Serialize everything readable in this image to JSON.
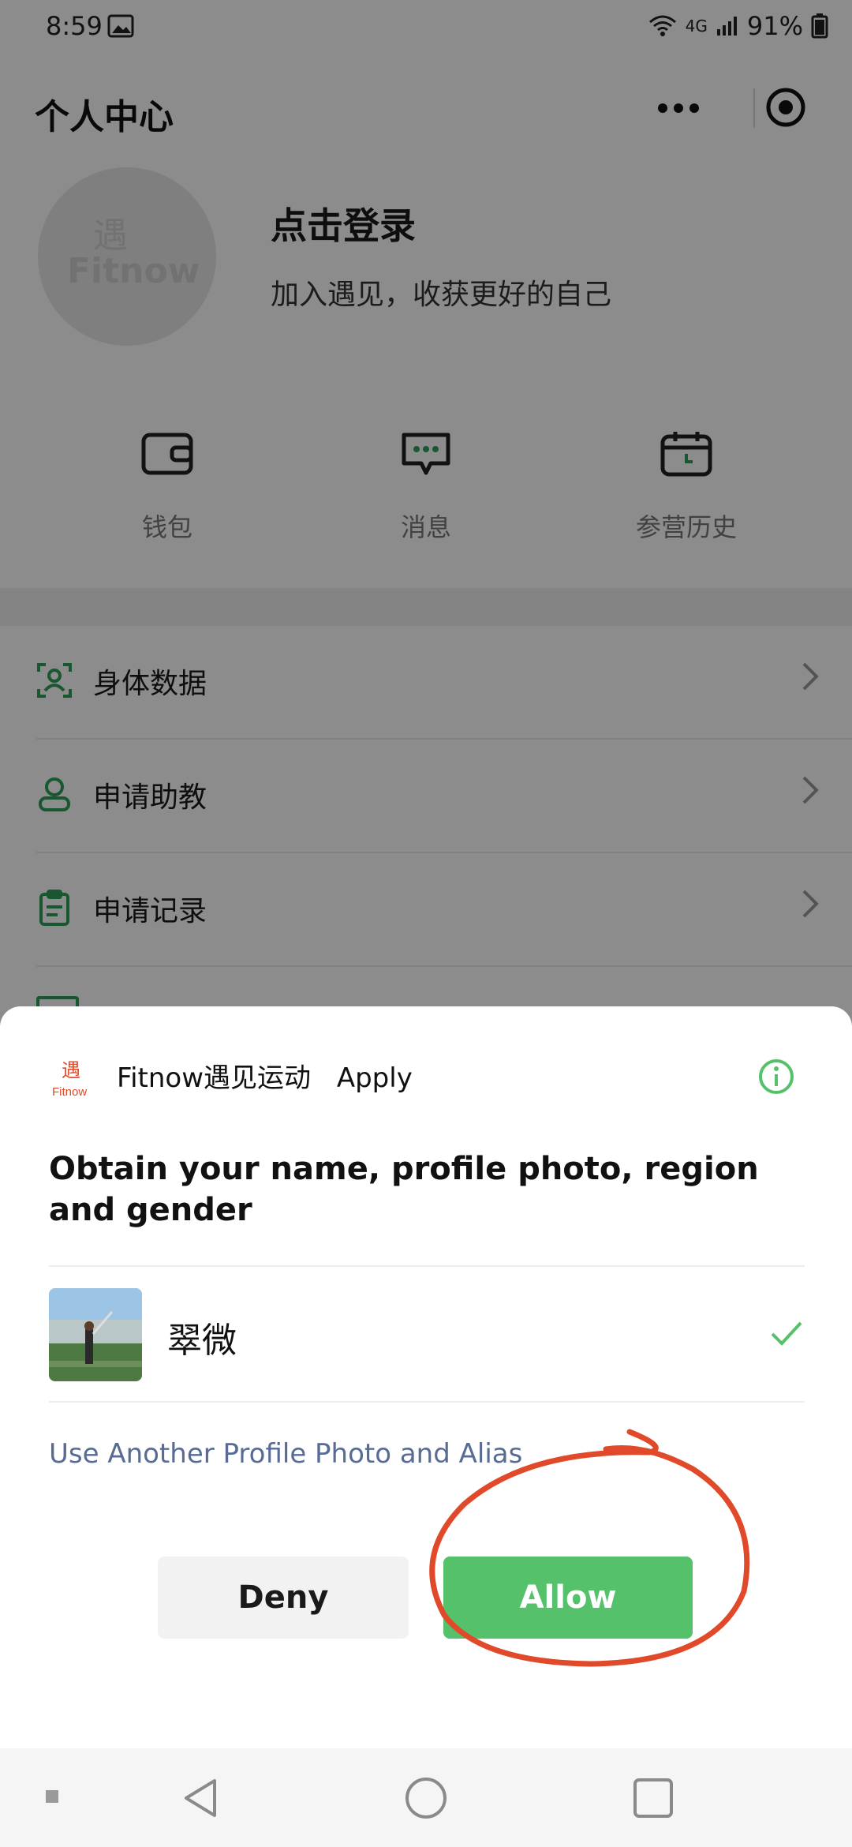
{
  "status_bar": {
    "time": "8:59",
    "network": "4G",
    "battery": "91%"
  },
  "header": {
    "title": "个人中心",
    "more_icon": "more-dots-icon",
    "capture_icon": "target-icon"
  },
  "profile": {
    "avatar_text": "Fitnow",
    "login_title": "点击登录",
    "login_subtitle": "加入遇见，收获更好的自己"
  },
  "quick_actions": [
    {
      "label": "钱包",
      "icon": "wallet-icon"
    },
    {
      "label": "消息",
      "icon": "message-icon"
    },
    {
      "label": "参营历史",
      "icon": "calendar-icon"
    }
  ],
  "menu": [
    {
      "label": "身体数据",
      "icon": "body-scan-icon"
    },
    {
      "label": "申请助教",
      "icon": "user-icon"
    },
    {
      "label": "申请记录",
      "icon": "clipboard-icon"
    }
  ],
  "auth_sheet": {
    "app_name": "Fitnow遇见运动",
    "action": "Apply",
    "permission_text": "Obtain your name, profile photo, region and gender",
    "profile_name": "翠微",
    "alt_link": "Use Another Profile Photo and Alias",
    "deny_label": "Deny",
    "allow_label": "Allow",
    "logo_text": "Fitnow"
  },
  "colors": {
    "accent_green": "#55c16a",
    "link_blue": "#576b95",
    "annotation_red": "#e04a2a",
    "icon_green": "#2e9e5a"
  }
}
